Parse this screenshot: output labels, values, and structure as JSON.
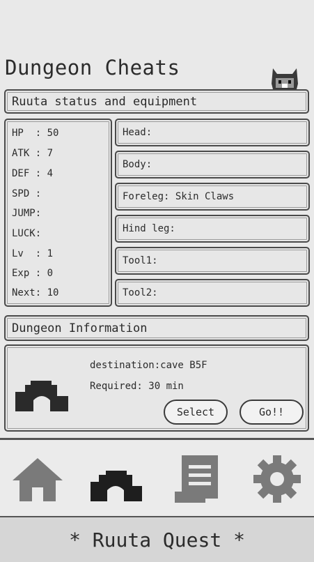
{
  "page": {
    "title": "Dungeon Cheats"
  },
  "status_section": {
    "label": "Ruuta status and equipment"
  },
  "stats": [
    {
      "label": "HP  : 50"
    },
    {
      "label": "ATK : 7"
    },
    {
      "label": "DEF : 4"
    },
    {
      "label": "SPD :"
    },
    {
      "label": "JUMP:"
    },
    {
      "label": "LUCK:"
    },
    {
      "label": "Lv  : 1"
    },
    {
      "label": "Exp : 0"
    },
    {
      "label": "Next: 10"
    }
  ],
  "equipment": [
    {
      "label": "Head:"
    },
    {
      "label": "Body:"
    },
    {
      "label": "Foreleg: Skin Claws"
    },
    {
      "label": "Hind leg:"
    },
    {
      "label": "Tool1:"
    },
    {
      "label": "Tool2:"
    }
  ],
  "dungeon": {
    "label": "Dungeon Information",
    "destination": "destination:cave B5F",
    "required": "Required: 30 min",
    "select_label": "Select",
    "go_label": "Go!!"
  },
  "tabs": [
    {
      "icon": "home-icon"
    },
    {
      "icon": "dungeon-icon",
      "active": true
    },
    {
      "icon": "scroll-icon"
    },
    {
      "icon": "gear-icon"
    }
  ],
  "footer": {
    "text": "* Ruuta Quest *"
  },
  "colors": {
    "active_icon": "#1e1e1e",
    "inactive_icon": "#7a7a7a",
    "background": "#e9e9e9"
  }
}
